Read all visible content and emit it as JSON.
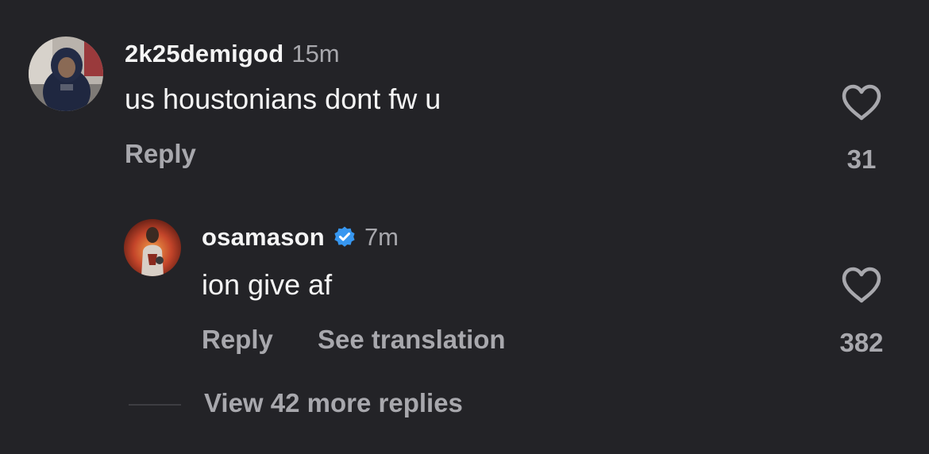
{
  "comments": [
    {
      "username": "2k25demigod",
      "verified": false,
      "time": "15m",
      "text": "us houstonians dont fw u",
      "reply_label": "Reply",
      "likes": "31",
      "like_icon": "heart-outline-icon"
    },
    {
      "username": "osamason",
      "verified": true,
      "verified_icon": "verified-badge-icon",
      "time": "7m",
      "text": "ion give af",
      "reply_label": "Reply",
      "translation_label": "See translation",
      "likes": "382",
      "like_icon": "heart-outline-icon"
    }
  ],
  "more_replies": "View 42 more replies",
  "colors": {
    "background": "#232327",
    "primary_text": "#f5f5f5",
    "secondary_text": "#a8a8ad",
    "verified": "#3797f0"
  }
}
